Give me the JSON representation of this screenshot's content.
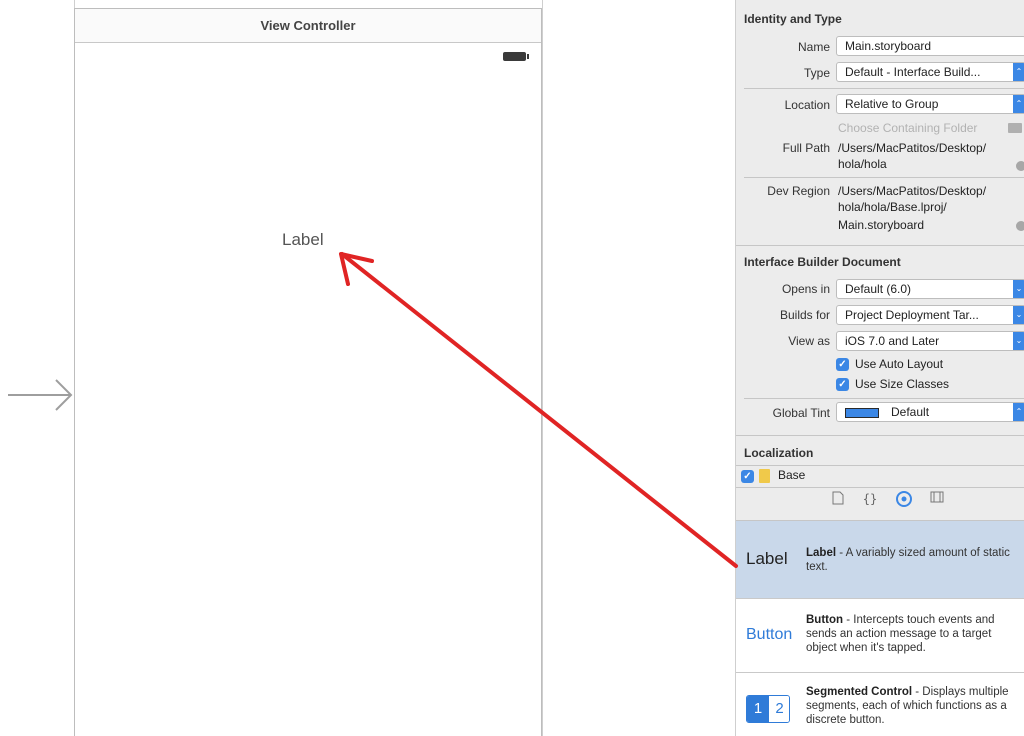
{
  "canvas": {
    "scene_title": "View Controller",
    "scene_label": "Label"
  },
  "inspector": {
    "identity": {
      "title": "Identity and Type",
      "name_label": "Name",
      "name_value": "Main.storyboard",
      "type_label": "Type",
      "type_value": "Default - Interface Build...",
      "location_label": "Location",
      "location_value": "Relative to Group",
      "choose_folder": "Choose Containing Folder",
      "full_path_label": "Full Path",
      "full_path_line1": "/Users/MacPatitos/Desktop/",
      "full_path_line2": "hola/hola",
      "dev_region_label": "Dev Region",
      "dev_region_line1": "/Users/MacPatitos/Desktop/",
      "dev_region_line2": "hola/hola/Base.lproj/",
      "dev_region_line3": "Main.storyboard"
    },
    "ib_document": {
      "title": "Interface Builder Document",
      "opens_in_label": "Opens in",
      "opens_in_value": "Default (6.0)",
      "builds_for_label": "Builds for",
      "builds_for_value": "Project Deployment Tar...",
      "view_as_label": "View as",
      "view_as_value": "iOS 7.0 and Later",
      "auto_layout": "Use Auto Layout",
      "auto_layout_checked": true,
      "size_classes": "Use Size Classes",
      "size_classes_checked": true,
      "global_tint_label": "Global Tint",
      "global_tint_value": "Default",
      "tint_color": "#3b87e5"
    },
    "localization": {
      "title": "Localization",
      "base_label": "Base",
      "base_checked": true
    },
    "library_tabs": [
      "file-icon",
      "braces-icon",
      "object-icon",
      "media-icon"
    ],
    "library": {
      "label_item": {
        "preview": "Label",
        "name": "Label",
        "desc": " - A variably sized amount of static text."
      },
      "button_item": {
        "preview": "Button",
        "name": "Button",
        "desc": " - Intercepts touch events and sends an action message to a target object when it's tapped."
      },
      "segmented_item": {
        "seg1": "1",
        "seg2": "2",
        "name": "Segmented Control",
        "desc": " - Displays multiple segments, each of which functions as a discrete button."
      }
    }
  },
  "colors": {
    "accent": "#3b87e5",
    "annotation_arrow": "#e02424",
    "selected_row": "#c9d8ea"
  }
}
